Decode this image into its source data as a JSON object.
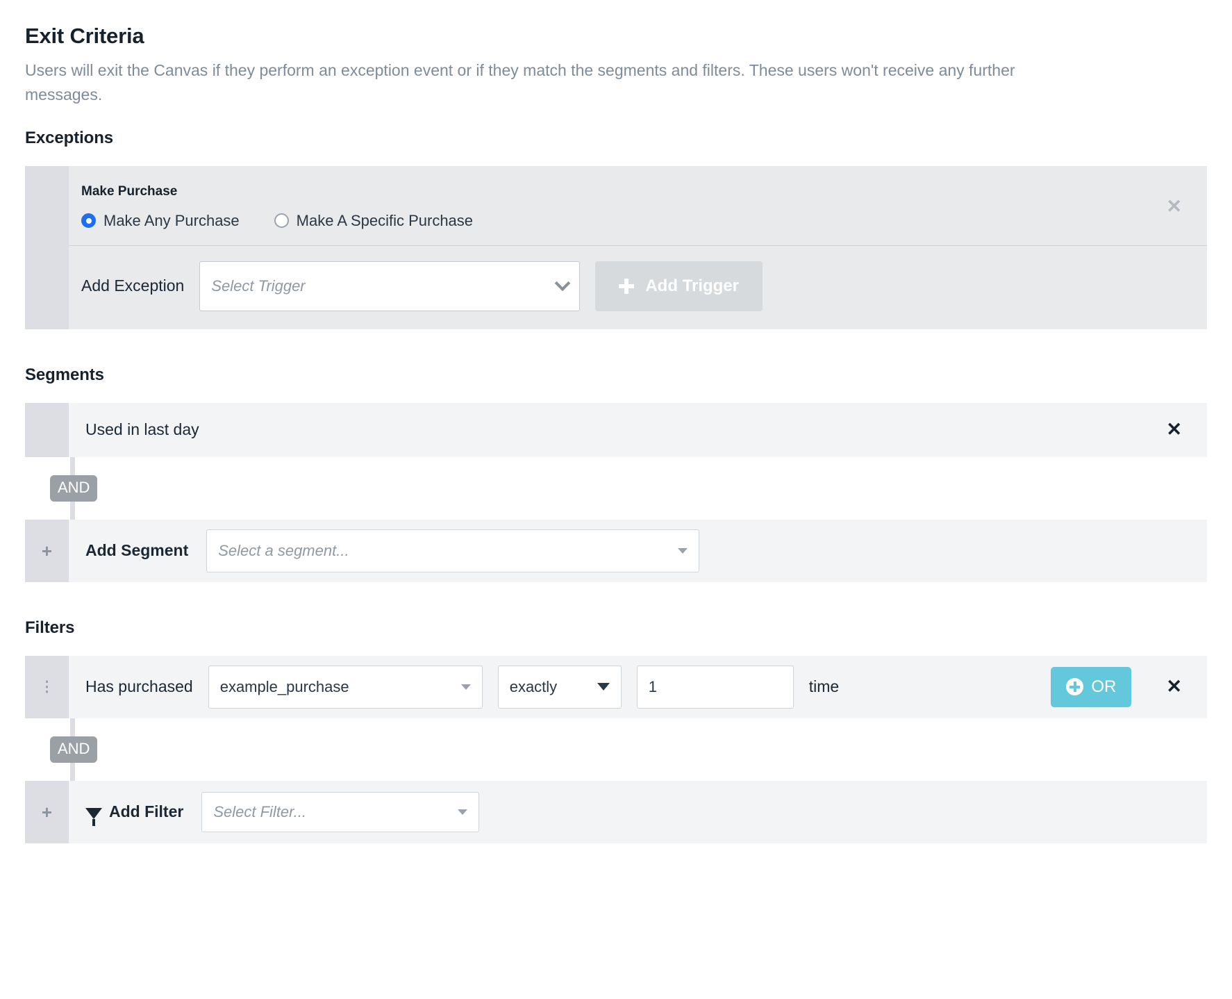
{
  "header": {
    "title": "Exit Criteria",
    "description": "Users will exit the Canvas if they perform an exception event or if they match the segments and filters. These users won't receive any further messages."
  },
  "exceptions": {
    "heading": "Exceptions",
    "card": {
      "title": "Make Purchase",
      "radios": [
        {
          "label": "Make Any Purchase",
          "selected": true
        },
        {
          "label": "Make A Specific Purchase",
          "selected": false
        }
      ],
      "remove_icon": "✕",
      "add_exception_label": "Add Exception",
      "trigger_placeholder": "Select Trigger",
      "add_trigger_label": "Add Trigger"
    }
  },
  "segments": {
    "heading": "Segments",
    "items": [
      {
        "name": "Used in last day",
        "remove_icon": "✕"
      }
    ],
    "connector": "AND",
    "add_row": {
      "plus": "+",
      "label": "Add Segment",
      "placeholder": "Select a segment..."
    }
  },
  "filters": {
    "heading": "Filters",
    "rows": [
      {
        "drag_handle": "⋮",
        "label": "Has purchased",
        "event": "example_purchase",
        "operator": "exactly",
        "count": "1",
        "unit": "time",
        "or_label": "OR",
        "remove_icon": "✕"
      }
    ],
    "connector": "AND",
    "add_row": {
      "plus": "+",
      "label": "Add Filter",
      "placeholder": "Select Filter..."
    }
  },
  "colors": {
    "accent_teal": "#63c8dc",
    "radio_blue": "#1c6ef2",
    "and_badge_gray": "#9ba0a6",
    "card_gray": "#e9eaec",
    "row_gray": "#f3f4f6",
    "handle_gray": "#dcdee3"
  }
}
